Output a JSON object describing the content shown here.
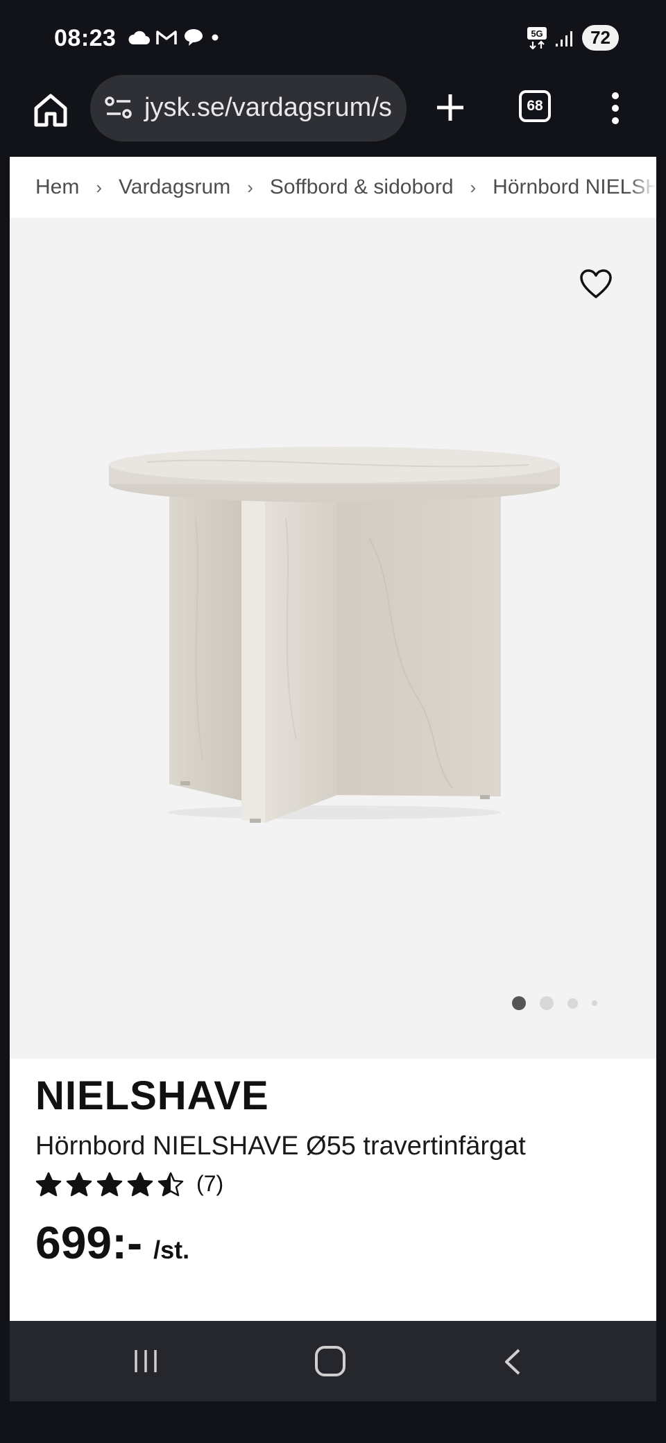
{
  "status_bar": {
    "time": "08:23",
    "network": "5G",
    "battery": "72",
    "left_icons": [
      "cloud-icon",
      "gmail-icon",
      "chat-bubble-icon",
      "dot-icon"
    ],
    "right_icons": [
      "5g-icon",
      "signal-icon"
    ]
  },
  "browser": {
    "url": "jysk.se/vardagsrum/s",
    "tab_count": "68",
    "icons": [
      "home-icon",
      "site-settings-icon",
      "plus-icon",
      "more-vert-icon"
    ]
  },
  "breadcrumb": {
    "items": [
      "Hem",
      "Vardagsrum",
      "Soffbord & sidobord",
      "Hörnbord NIELSHAVE"
    ],
    "separator": "›"
  },
  "gallery": {
    "image_count": 4,
    "active_index": 0,
    "favorite_icon": "heart-outline-icon"
  },
  "product": {
    "brand": "NIELSHAVE",
    "name": "Hörnbord NIELSHAVE Ø55 travertinfärgat",
    "rating": 4.5,
    "rating_max": 5,
    "review_count": "(7)",
    "price": "699:-",
    "unit": "/st."
  },
  "colors": {
    "status_bg": "#121318",
    "url_pill": "#2f3035",
    "gallery_bg": "#f3f3f3",
    "text": "#111111",
    "navbar": "#26272c"
  },
  "navbar": {
    "icons": [
      "recents-icon",
      "home-nav-icon",
      "back-icon"
    ]
  }
}
